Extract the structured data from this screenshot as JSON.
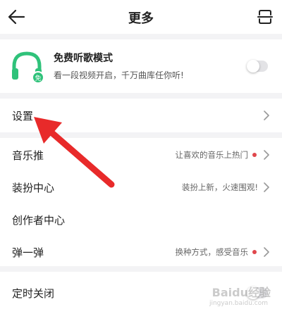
{
  "header": {
    "title": "更多"
  },
  "mode_card": {
    "title": "免费听歌模式",
    "description": "看一段视频开启，千万曲库任你听!",
    "toggle_on": false,
    "accent_color": "#2fc27a"
  },
  "settings": {
    "label": "设置"
  },
  "list": [
    {
      "label": "音乐推",
      "sub": "让喜欢的音乐上热门",
      "dot": true
    },
    {
      "label": "装扮中心",
      "sub": "装扮上新，火速围观!",
      "dot": false
    },
    {
      "label": "创作者中心",
      "sub": "",
      "dot": false
    },
    {
      "label": "弹一弹",
      "sub": "换种方式，感受音乐",
      "dot": true
    }
  ],
  "timer": {
    "label": "定时关闭",
    "toggle_on": false
  },
  "annotation_color": "#e82a2a",
  "watermark": {
    "brand": "Baidu经验",
    "url": "jingyan.baidu.com"
  }
}
